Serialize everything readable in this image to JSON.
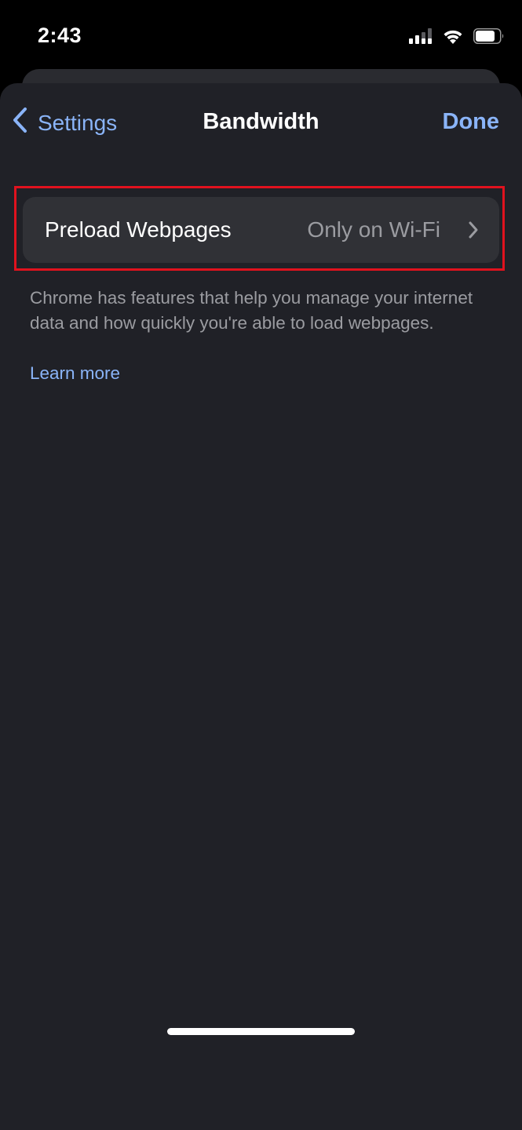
{
  "status_bar": {
    "time": "2:43",
    "icons": [
      "cellular-signal-icon",
      "wifi-icon",
      "battery-icon"
    ]
  },
  "nav": {
    "back_label": "Settings",
    "title": "Bandwidth",
    "done_label": "Done"
  },
  "settings": {
    "preload": {
      "label": "Preload Webpages",
      "value": "Only on Wi-Fi"
    }
  },
  "footer": {
    "description": "Chrome has features that help you manage your internet data and how quickly you're able to load webpages.",
    "learn_more": "Learn more"
  },
  "colors": {
    "accent": "#8ab4f8",
    "sheet_background": "#202127",
    "row_background": "#303136",
    "highlight": "#e0121e"
  }
}
